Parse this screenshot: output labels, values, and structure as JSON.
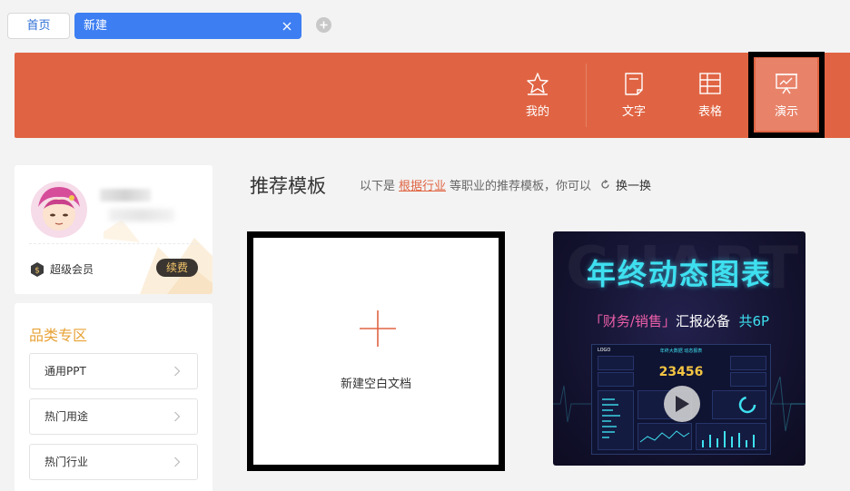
{
  "tabs": {
    "home_label": "首页",
    "new_label": "新建"
  },
  "banner": {
    "nav": {
      "mine": "我的",
      "text": "文字",
      "table": "表格",
      "present": "演示"
    },
    "accent_color": "#e06443"
  },
  "profile": {
    "member_label": "超级会员",
    "renew_label": "续费"
  },
  "categories": {
    "title": "品类专区",
    "items": [
      {
        "label": "通用PPT"
      },
      {
        "label": "热门用途"
      },
      {
        "label": "热门行业"
      }
    ]
  },
  "main": {
    "title": "推荐模板",
    "desc_prefix": "以下是",
    "desc_link": "根据行业",
    "desc_suffix": "等职业的推荐模板，你可以",
    "refresh_label": "换一换",
    "new_blank_label": "新建空白文档"
  },
  "template": {
    "bg_word": "CHART",
    "title": "年终动态图表",
    "sub_a": "「财务/销售」",
    "sub_b": "汇报必备",
    "sub_c": "共6P",
    "screen_logo": "LOGO",
    "screen_title": "年终大数据 动态报表",
    "screen_number": "23456"
  }
}
